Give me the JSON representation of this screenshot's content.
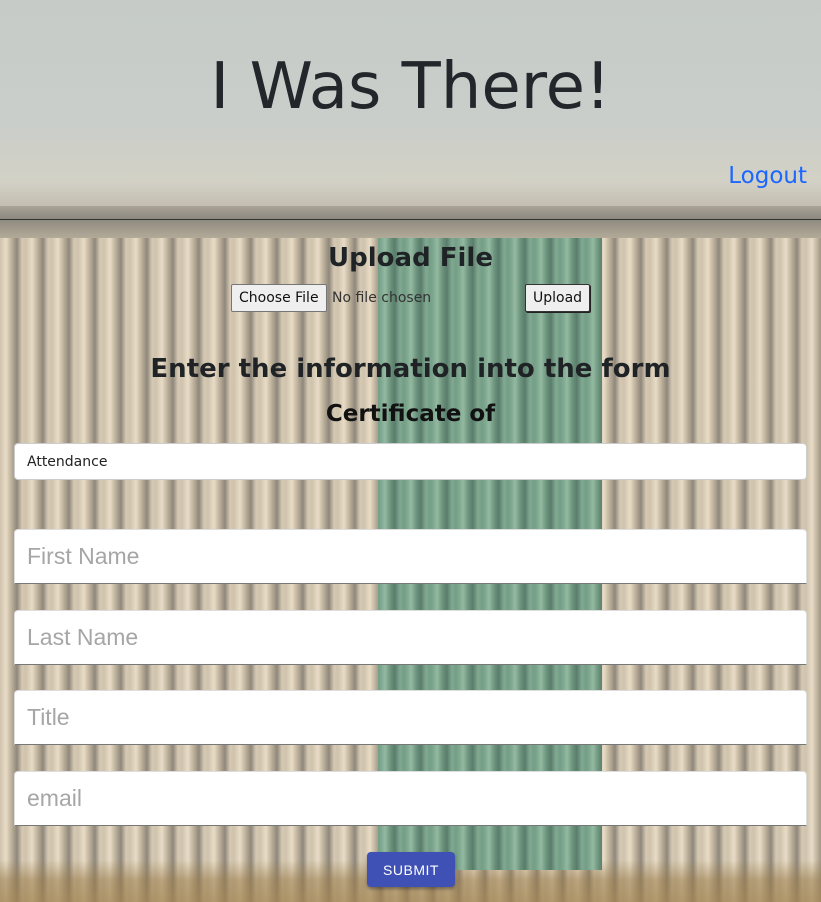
{
  "header": {
    "title": "I Was There!",
    "logout_label": "Logout"
  },
  "upload": {
    "heading": "Upload File",
    "choose_file_label": "Choose File",
    "no_file_text": "No file chosen",
    "upload_label": "Upload"
  },
  "form": {
    "heading": "Enter the information into the form",
    "certificate_heading": "Certificate of",
    "certificate_type_selected": "Attendance",
    "fields": {
      "first_name_placeholder": "First Name",
      "last_name_placeholder": "Last Name",
      "title_placeholder": "Title",
      "email_placeholder": "email"
    },
    "submit_label": "SUBMIT"
  },
  "colors": {
    "link": "#1a66ff",
    "submit_button": "#3f51b5"
  }
}
